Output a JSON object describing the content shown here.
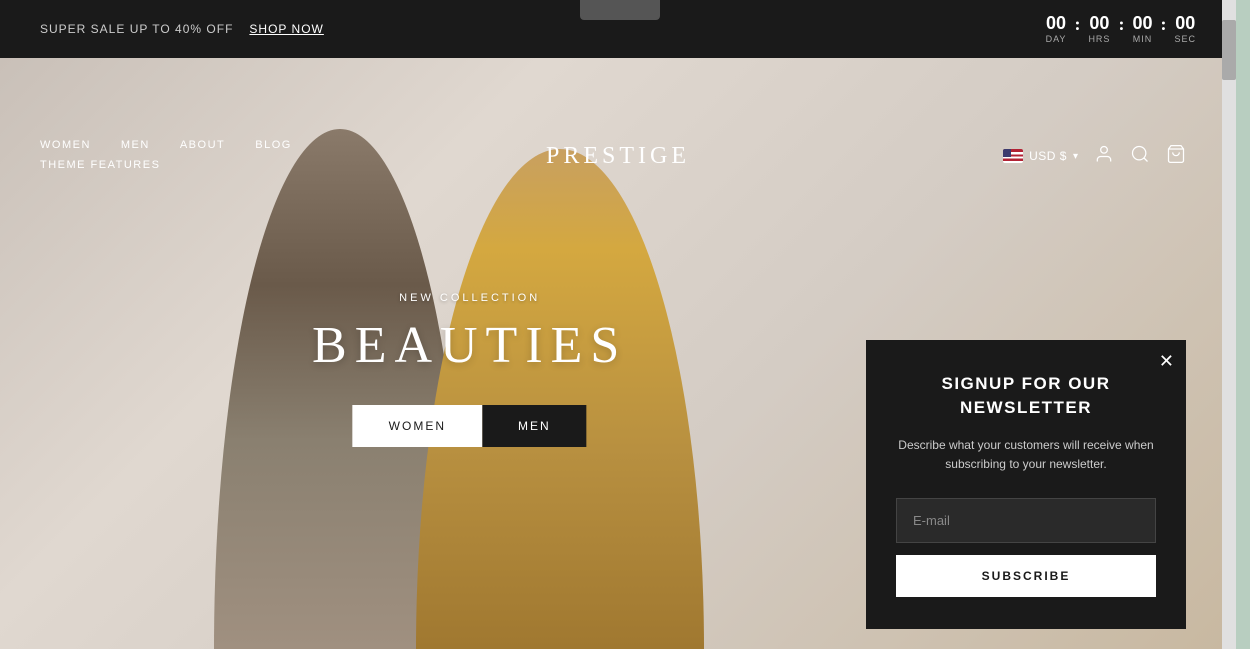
{
  "announcement": {
    "text": "SUPER SALE UP TO 40% OFF",
    "shop_now_label": "SHOP NOW"
  },
  "countdown": {
    "day_value": "00",
    "day_label": "DAY",
    "hrs_value": "00",
    "hrs_label": "HRS",
    "min_value": "00",
    "min_label": "MIN",
    "sec_value": "00",
    "sec_label": "SEC"
  },
  "nav": {
    "items": [
      {
        "label": "WOMEN"
      },
      {
        "label": "MEN"
      },
      {
        "label": "ABOUT"
      },
      {
        "label": "BLOG"
      }
    ],
    "bottom_item": "THEME FEATURES",
    "logo": "PRESTIGE",
    "currency": "USD $",
    "currency_chevron": "▾"
  },
  "hero": {
    "subtitle": "NEW COLLECTION",
    "title": "BEAUTIES",
    "btn_women": "WOMEN",
    "btn_men": "MEN"
  },
  "newsletter": {
    "title": "SIGNUP FOR OUR NEWSLETTER",
    "description": "Describe what your customers will receive when subscribing to your newsletter.",
    "email_placeholder": "E-mail",
    "subscribe_label": "SUBSCRIBE",
    "close_icon": "✕"
  }
}
